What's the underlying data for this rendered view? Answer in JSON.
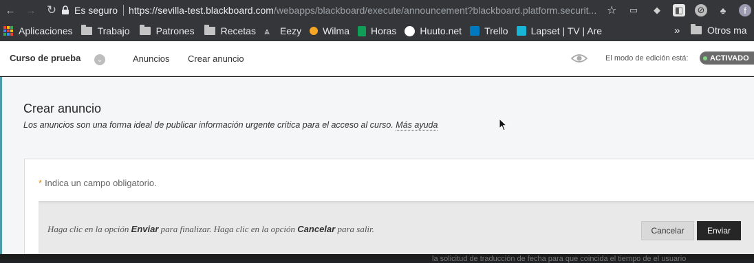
{
  "browser": {
    "secure_label": "Es seguro",
    "url_strong": "https://sevilla-test.blackboard.com",
    "url_dim": "/webapps/blackboard/execute/announcement?blackboard.platform.securit..."
  },
  "bookmarks": [
    {
      "label": "Aplicaciones",
      "icon": "apps-grid-icon"
    },
    {
      "label": "Trabajo",
      "icon": "folder-icon"
    },
    {
      "label": "Patrones",
      "icon": "folder-icon"
    },
    {
      "label": "Recetas",
      "icon": "folder-icon"
    },
    {
      "label": "Eezy",
      "icon": "eezy-icon"
    },
    {
      "label": "Wilma",
      "icon": "wilma-icon"
    },
    {
      "label": "Horas",
      "icon": "sheets-icon"
    },
    {
      "label": "Huuto.net",
      "icon": "huuto-icon"
    },
    {
      "label": "Trello",
      "icon": "trello-icon"
    },
    {
      "label": "Lapset | TV | Are",
      "icon": "yle-icon"
    }
  ],
  "bookmarks_overflow": "»",
  "other_bookmarks": "Otros ma",
  "header": {
    "course_name": "Curso de prueba",
    "nav": [
      "Anuncios",
      "Crear anuncio"
    ],
    "edit_mode_label": "El modo de edición está:",
    "edit_mode_value": "ACTIVADO"
  },
  "page": {
    "title": "Crear anuncio",
    "description": "Los anuncios son una forma ideal de publicar información urgente crítica para el acceso al curso.",
    "help_link": "Más ayuda",
    "required_asterisk": "*",
    "required_note": "Indica un campo obligatorio.",
    "submit_instructions": {
      "part1": "Haga clic en la opción ",
      "bold1": "Enviar",
      "part2": " para finalizar. Haga clic en la opción ",
      "bold2": "Cancelar",
      "part3": " para salir."
    },
    "cancel_button": "Cancelar",
    "submit_button": "Enviar"
  },
  "bottom_fragment": "la solicitud de traducción de fecha para que coincida el tiempo de el usuario",
  "colors": {
    "accent": "#4a9aa8",
    "submit_button_bg": "#262626",
    "required_asterisk": "#e08b16",
    "toggle_dot": "#7fd57f"
  }
}
